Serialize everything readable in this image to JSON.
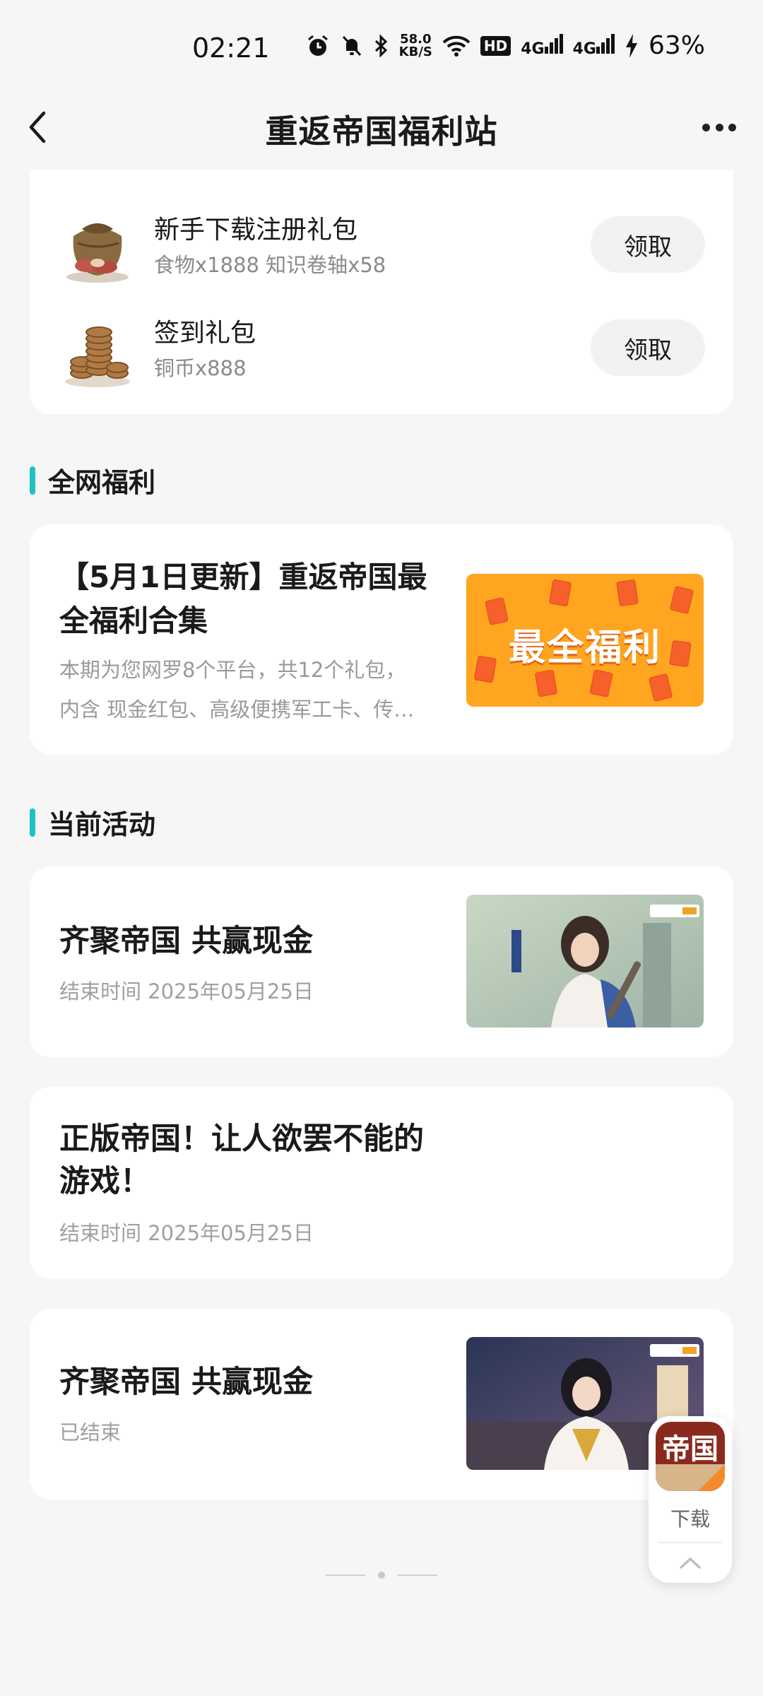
{
  "status_bar": {
    "time": "02:21",
    "net_speed_value": "58.0",
    "net_speed_unit": "KB/S",
    "hd_label": "HD",
    "sig1": "4G",
    "sig2": "4G",
    "battery": "63%"
  },
  "header": {
    "title": "重返帝国福利站"
  },
  "gifts": [
    {
      "title": "新手下载注册礼包",
      "subtitle": "食物x1888 知识卷轴x58",
      "button": "领取"
    },
    {
      "title": "签到礼包",
      "subtitle": "铜币x888",
      "button": "领取"
    }
  ],
  "sections": {
    "welfare": "全网福利",
    "activities": "当前活动"
  },
  "welfare_article": {
    "title_line1": "【5月1日更新】重返帝国最",
    "title_line2": "全福利合集",
    "desc_line1": "本期为您网罗8个平台，共12个礼包，",
    "desc_line2": "内含 现金红包、高级便携军工卡、传…",
    "thumb_text": "最全福利"
  },
  "activities": [
    {
      "title": "齐聚帝国 共赢现金",
      "time": "结束时间 2025年05月25日"
    },
    {
      "title_line1": "正版帝国！让人欲罢不能的",
      "title_line2": "游戏！",
      "time": "结束时间 2025年05月25日"
    },
    {
      "title": "齐聚帝国 共赢现金",
      "time": "已结束"
    }
  ],
  "float_widget": {
    "logo_text": "帝国",
    "label": "下载"
  },
  "colors": {
    "accent": "#1bc2c2",
    "background": "#f6f6f6",
    "thumb_orange": "#ffa51f"
  }
}
